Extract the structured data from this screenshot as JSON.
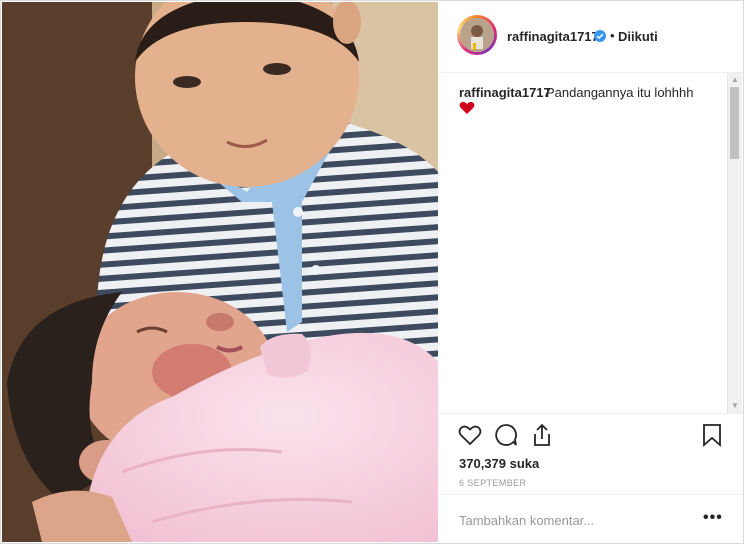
{
  "post": {
    "username": "raffinagita1717",
    "separator": "•",
    "follow_label": "Diikuti",
    "caption_user": "raffinagita1717",
    "caption_text": "Pandangannya itu lohhhh",
    "caption_emoji": "red-heart",
    "likes": "370,379 suka",
    "date": "6 SEPTEMBER",
    "comment_placeholder": "Tambahkan komentar...",
    "more_label": "•••"
  },
  "icons": {
    "like": "heart-outline-icon",
    "comment": "speech-bubble-icon",
    "share": "share-icon",
    "save": "bookmark-icon",
    "verified": "verified-badge-icon"
  },
  "colors": {
    "verified": "#3897f0",
    "heart": "#ed4956",
    "text": "#262626",
    "muted": "#999999"
  }
}
